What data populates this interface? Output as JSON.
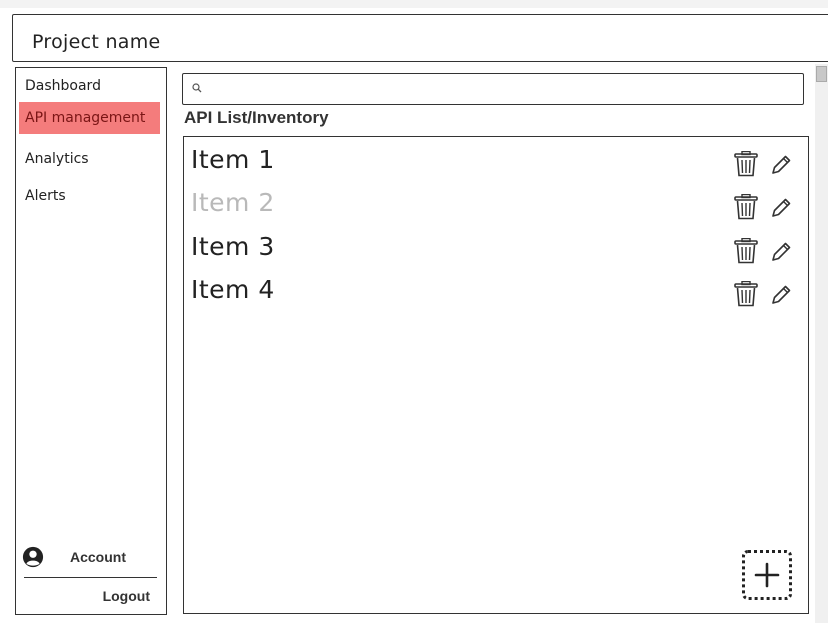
{
  "header": {
    "title": "Project name"
  },
  "sidebar": {
    "items": [
      {
        "label": "Dashboard",
        "active": false
      },
      {
        "label": "API management",
        "active": true
      },
      {
        "label": "Analytics",
        "active": false
      },
      {
        "label": "Alerts",
        "active": false
      }
    ],
    "account_label": "Account",
    "logout_label": "Logout"
  },
  "search": {
    "value": "",
    "placeholder": ""
  },
  "main": {
    "section_title": "API List/Inventory",
    "items": [
      {
        "label": "Item 1",
        "disabled": false
      },
      {
        "label": "Item 2",
        "disabled": true
      },
      {
        "label": "Item 3",
        "disabled": false
      },
      {
        "label": "Item 4",
        "disabled": false
      }
    ]
  },
  "icons": {
    "search": "search-icon",
    "delete": "trash-icon",
    "edit": "pencil-icon",
    "add": "plus-icon",
    "account": "user-circle-icon"
  },
  "colors": {
    "active_nav_bg": "#f47c7c",
    "active_nav_text": "#7a1515",
    "disabled_item_text": "#b9b9b9",
    "stroke": "#333333"
  }
}
